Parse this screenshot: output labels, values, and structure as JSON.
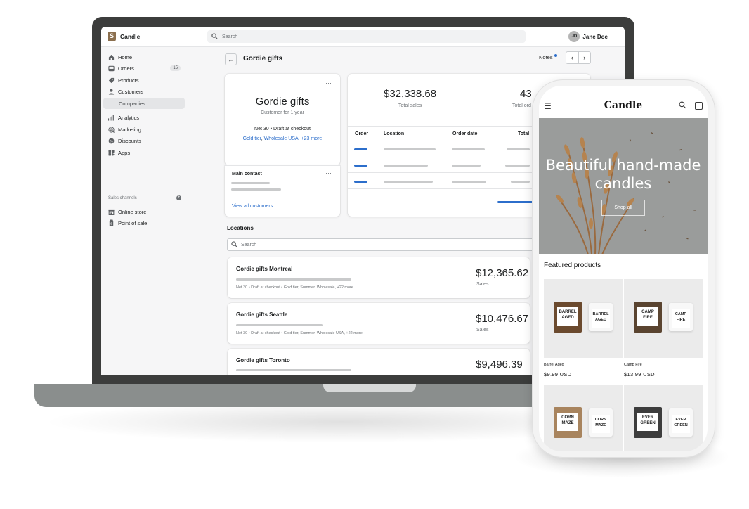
{
  "admin": {
    "store_name": "Candle",
    "search_placeholder": "Search",
    "user": {
      "initials": "JD",
      "name": "Jane Doe"
    },
    "sidebar": {
      "items": [
        {
          "label": "Home",
          "icon": "home-icon"
        },
        {
          "label": "Orders",
          "icon": "orders-icon",
          "badge": "15"
        },
        {
          "label": "Products",
          "icon": "tag-icon"
        },
        {
          "label": "Customers",
          "icon": "person-icon"
        },
        {
          "label": "Companies",
          "icon": "",
          "active": true
        },
        {
          "label": "Analytics",
          "icon": "bar-chart-icon"
        },
        {
          "label": "Marketing",
          "icon": "target-icon"
        },
        {
          "label": "Discounts",
          "icon": "discount-icon"
        },
        {
          "label": "Apps",
          "icon": "apps-icon"
        }
      ],
      "sales_channels_heading": "Sales channels",
      "channels": [
        {
          "label": "Online store",
          "icon": "store-icon"
        },
        {
          "label": "Point of sale",
          "icon": "pos-icon"
        }
      ]
    },
    "page": {
      "title": "Gordie gifts",
      "notes_label": "Notes",
      "company_card": {
        "name": "Gordie gifts",
        "subtitle": "Customer for 1 year",
        "terms": "Net 30 • Draft at checkout",
        "tags": [
          "Gold tier",
          "Wholesale USA",
          "+23 more"
        ]
      },
      "main_contact": {
        "title": "Main contact",
        "link": "View all customers"
      },
      "stats": {
        "total_sales_value": "$32,338.68",
        "total_sales_label": "Total sales",
        "total_orders_value": "43",
        "total_orders_label": "Total ord"
      },
      "orders_table": {
        "headers": [
          "Order",
          "Location",
          "Order date",
          "Total"
        ]
      },
      "locations": {
        "title": "Locations",
        "search_placeholder": "Search",
        "items": [
          {
            "name": "Gordie gifts Montreal",
            "meta": "Net 30  •  Draft at checkout  •  Gold tier, Summer, Wholesale, +22 more",
            "amount": "$12,365.62",
            "amount_label": "Sales"
          },
          {
            "name": "Gordie gifts Seattle",
            "meta": "Net 30  •  Draft at checkout  •  Gold tier, Summer, Wholesale USA, +22 more",
            "amount": "$10,476.67",
            "amount_label": "Sales"
          },
          {
            "name": "Gordie gifts Toronto",
            "meta": "",
            "amount": "$9,496.39",
            "amount_label": ""
          }
        ]
      }
    }
  },
  "storefront": {
    "logo": "Candle",
    "hero_title": "Beautiful hand-made candles",
    "hero_button": "Shop all",
    "featured_title": "Featured products",
    "products": [
      {
        "name": "Barrel Aged",
        "price": "$9.99 USD",
        "label_line1": "BARREL",
        "label_line2": "AGED",
        "box_color": "#6b4a2e"
      },
      {
        "name": "Camp Fire",
        "price": "$13.99 USD",
        "label_line1": "CAMP",
        "label_line2": "FIRE",
        "box_color": "#5a4430"
      },
      {
        "name": "",
        "price": "",
        "label_line1": "CORN",
        "label_line2": "MAZE",
        "box_color": "#a8845e"
      },
      {
        "name": "",
        "price": "",
        "label_line1": "EVER",
        "label_line2": "GREEN",
        "box_color": "#3d3d3d"
      }
    ]
  },
  "colors": {
    "accent_blue": "#2c6ecb",
    "laptop_frame": "#3c3d3c",
    "laptop_base": "#8a8e8d"
  }
}
